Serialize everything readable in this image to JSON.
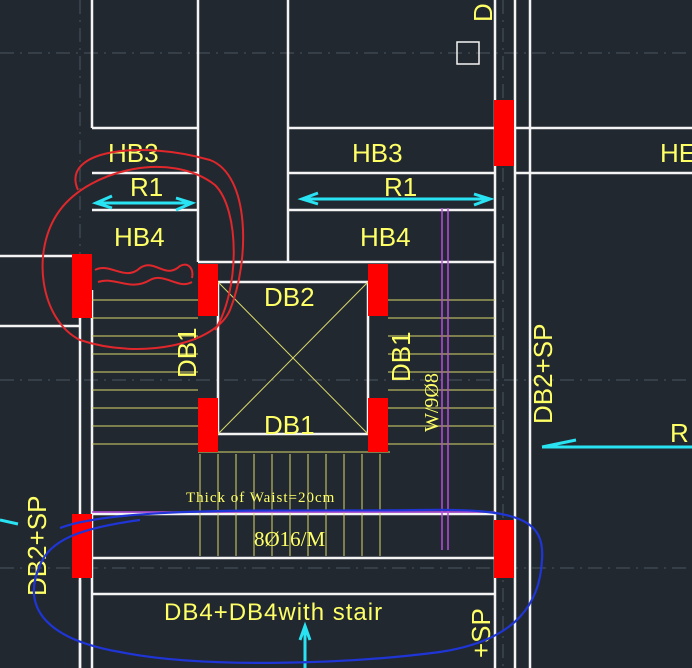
{
  "labels": {
    "hb3_left": "HB3",
    "hb3_mid": "HB3",
    "hb3_right": "HE",
    "r1_left": "R1",
    "r1_mid": "R1",
    "r_right": "R",
    "hb4_left": "HB4",
    "hb4_mid": "HB4",
    "db2_top": "DB2",
    "db1_bottom": "DB1",
    "db1_left": "DB1",
    "db1_right": "DB1",
    "db2sp_right": "DB2+SP",
    "db2sp_left": "DB2+SP",
    "sp_bottom": "+SP",
    "d_top": "D",
    "w_rebar": "W/9Ø8",
    "waist_note": "Thick of Waist=20cm",
    "rebar_bottom": "8Ø16/M",
    "db4_stair": "DB4+DB4with stair"
  },
  "colors": {
    "background": "#212830",
    "wall": "#f4f4f4",
    "column": "#ff0000",
    "text": "#ffff66",
    "arrow": "#29e3f3",
    "stair_line": "#d9d96a",
    "rebar_line": "#b94de0",
    "markup_red": "#e0272b",
    "markup_blue": "#1f35d6",
    "grid": "#4a5560"
  }
}
